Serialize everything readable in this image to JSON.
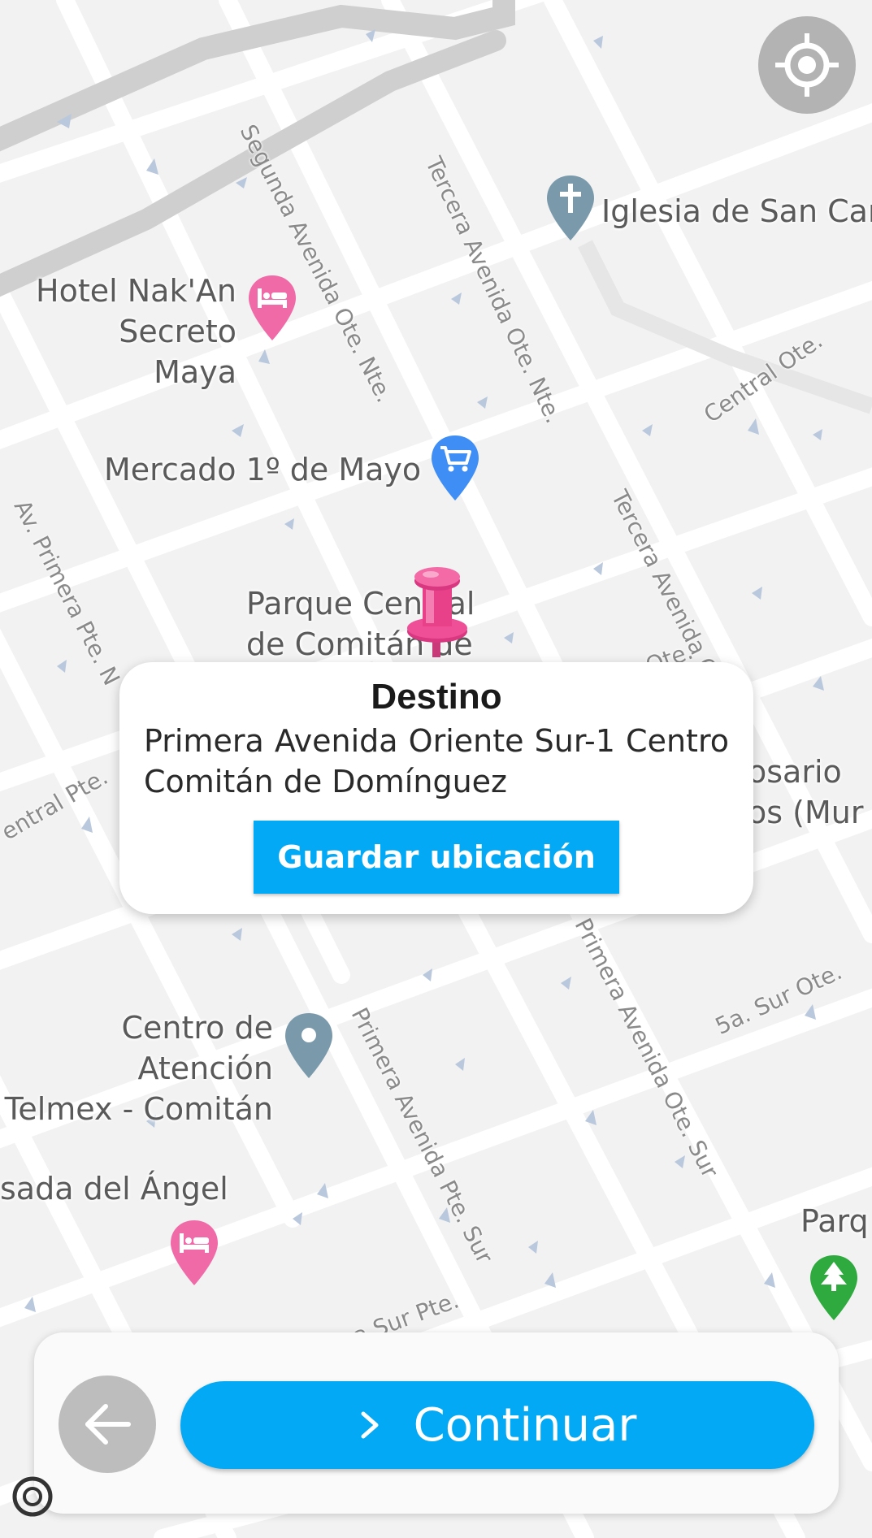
{
  "map": {
    "labels": {
      "hotel_nakan": "Hotel Nak'An\nSecreto Maya",
      "iglesia": "Iglesia de San Car",
      "mercado": "Mercado 1º de Mayo",
      "parque_central": "Parque Central\nde Comitán de",
      "rosario": "osario\nos (Mur",
      "centro_atencion": "Centro de Atención\nTelmex - Comitán",
      "posada": "sada del Ángel",
      "parque_right": "Parq"
    },
    "streets": {
      "segunda_av": "Segunda Avenida Ote. Nte.",
      "tercera_av_nte": "Tercera Avenida Ote. Nte.",
      "central_ote": "Central Ote.",
      "tercera_av_sur": "Tercera Avenida Ote. Sur",
      "av_primera_pte": "Av. Primera Pte. N",
      "central_pte": "entral Pte.",
      "ote_fragment": "Ote.",
      "primera_av_pte_sur": "Primera Avenida Pte. Sur",
      "primera_av_ote_sur": "Primera Avenida Ote. Sur",
      "quinta_sur_ote": "5a. Sur Ote.",
      "sur_pte": "a Sur Pte."
    },
    "icons": {
      "locate": "crosshair-icon",
      "church": "church-icon",
      "hotel": "bed-icon",
      "market": "cart-icon",
      "generic": "place-icon",
      "park": "tree-icon",
      "pushpin": "pushpin-icon"
    },
    "colors": {
      "hotel_pin": "#f06aa8",
      "church_pin": "#7a9aab",
      "market_pin": "#3f8ef5",
      "park_pin": "#2eaa3f",
      "pushpin": "#e8418a"
    }
  },
  "popup": {
    "title": "Destino",
    "address": "Primera Avenida Oriente Sur-1 Centro Comitán de Domínguez",
    "save_label": "Guardar ubicación"
  },
  "bottom": {
    "back_icon": "arrow-left-icon",
    "continue_icon": "chevron-right-icon",
    "continue_label": "Continuar"
  },
  "theme": {
    "accent": "#03a9f4"
  }
}
